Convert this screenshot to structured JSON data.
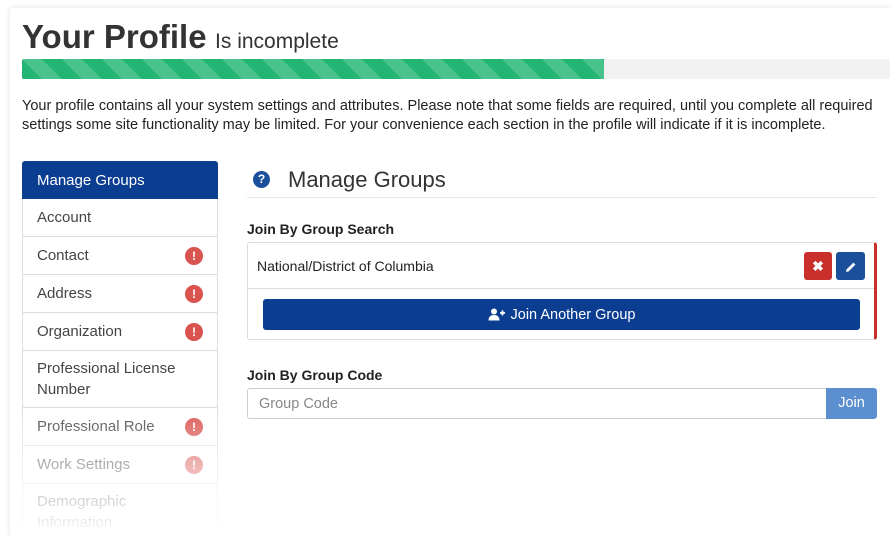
{
  "header": {
    "title": "Your Profile",
    "subtitle": "Is incomplete",
    "progress_fraction": 0.67
  },
  "intro_text": "Your profile contains all your system settings and attributes. Please note that some fields are required, until you complete all required settings some site functionality may be limited. For your convenience each section in the profile will indicate if it is incomplete.",
  "sidebar": {
    "items": [
      {
        "label": "Manage Groups",
        "active": true,
        "alert": false
      },
      {
        "label": "Account",
        "active": false,
        "alert": false
      },
      {
        "label": "Contact",
        "active": false,
        "alert": true
      },
      {
        "label": "Address",
        "active": false,
        "alert": true
      },
      {
        "label": "Organization",
        "active": false,
        "alert": true
      },
      {
        "label": "Professional License Number",
        "active": false,
        "alert": false
      },
      {
        "label": "Professional Role",
        "active": false,
        "alert": true
      },
      {
        "label": "Work Settings",
        "active": false,
        "alert": true
      },
      {
        "label": "Demographic Information",
        "active": false,
        "alert": false
      }
    ],
    "alert_glyph": "!"
  },
  "main": {
    "section_title": "Manage Groups",
    "help_glyph": "?",
    "join_by_search_label": "Join By Group Search",
    "groups": [
      {
        "name": "National/District of Columbia"
      }
    ],
    "join_another_label": "Join Another Group",
    "join_by_code_label": "Join By Group Code",
    "code_placeholder": "Group Code",
    "join_button_label": "Join"
  },
  "colors": {
    "primary": "#0b3d91",
    "success": "#22b573",
    "danger": "#d9534f",
    "join_button": "#5b8fd0"
  },
  "icons": {
    "help": "question-circle-icon",
    "alert": "exclamation-circle-icon",
    "delete": "times-icon",
    "edit": "pencil-icon",
    "add_user": "user-plus-icon"
  }
}
